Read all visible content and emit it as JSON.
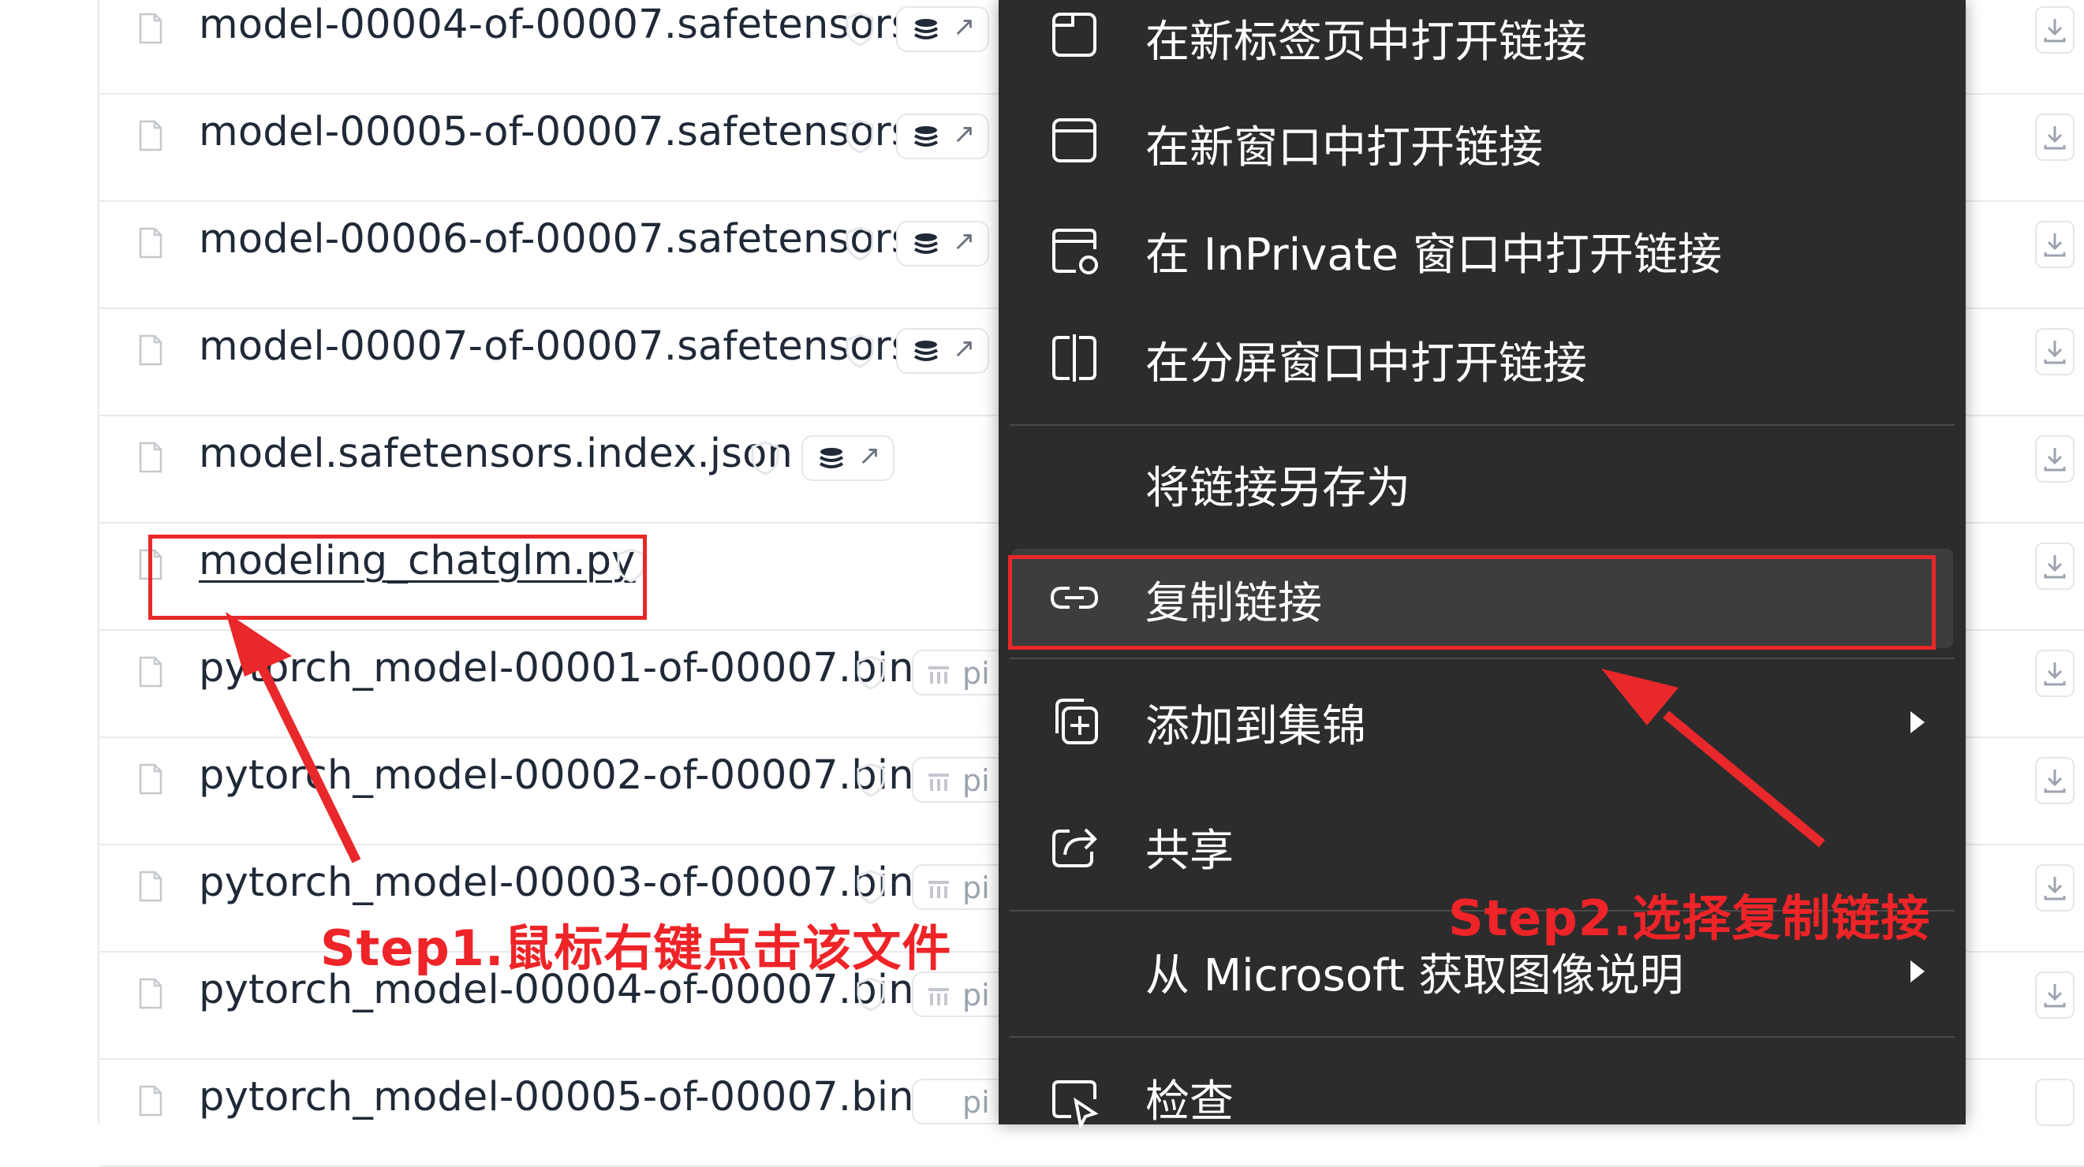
{
  "files": [
    {
      "name": "model-00004-of-00007.safetensors",
      "badge": "stack",
      "badge_arrow": "↗"
    },
    {
      "name": "model-00005-of-00007.safetensors",
      "badge": "stack",
      "badge_arrow": "↗"
    },
    {
      "name": "model-00006-of-00007.safetensors",
      "badge": "stack",
      "badge_arrow": "↗"
    },
    {
      "name": "model-00007-of-00007.safetensors",
      "badge": "stack",
      "badge_arrow": "↗"
    },
    {
      "name": "model.safetensors.index.json",
      "badge": "stack",
      "badge_arrow": "↗"
    },
    {
      "name": "modeling_chatglm.py",
      "badge": "none"
    },
    {
      "name": "pytorch_model-00001-of-00007.bin",
      "badge": "pickle",
      "badge_text": "pi"
    },
    {
      "name": "pytorch_model-00002-of-00007.bin",
      "badge": "pickle",
      "badge_text": "pi"
    },
    {
      "name": "pytorch_model-00003-of-00007.bin",
      "badge": "pickle",
      "badge_text": "pi"
    },
    {
      "name": "pytorch_model-00004-of-00007.bin",
      "badge": "pickle",
      "badge_text": "pi"
    },
    {
      "name": "pytorch_model-00005-of-00007.bin",
      "badge": "pickle",
      "badge_text": "pi"
    }
  ],
  "context_menu": {
    "items": [
      {
        "label": "在新标签页中打开链接",
        "icon": "new-tab-icon"
      },
      {
        "label": "在新窗口中打开链接",
        "icon": "new-window-icon"
      },
      {
        "label": "在 InPrivate 窗口中打开链接",
        "icon": "inprivate-window-icon"
      },
      {
        "label": "在分屏窗口中打开链接",
        "icon": "split-screen-icon"
      },
      {
        "label": "将链接另存为",
        "icon": ""
      },
      {
        "label": "复制链接",
        "icon": "link-icon",
        "highlighted": true
      },
      {
        "label": "添加到集锦",
        "icon": "add-to-collections-icon",
        "submenu": true
      },
      {
        "label": "共享",
        "icon": "share-icon"
      },
      {
        "label": "从 Microsoft 获取图像说明",
        "icon": "",
        "submenu": true
      },
      {
        "label": "检查",
        "icon": "inspect-icon"
      }
    ]
  },
  "annotations": {
    "step1": "Step1.鼠标右键点击该文件",
    "step2": "Step2.选择复制链接"
  },
  "colors": {
    "annotation_red": "#e8282a",
    "menu_background": "#2c2c2c",
    "menu_highlight": "#3d3d3d"
  }
}
